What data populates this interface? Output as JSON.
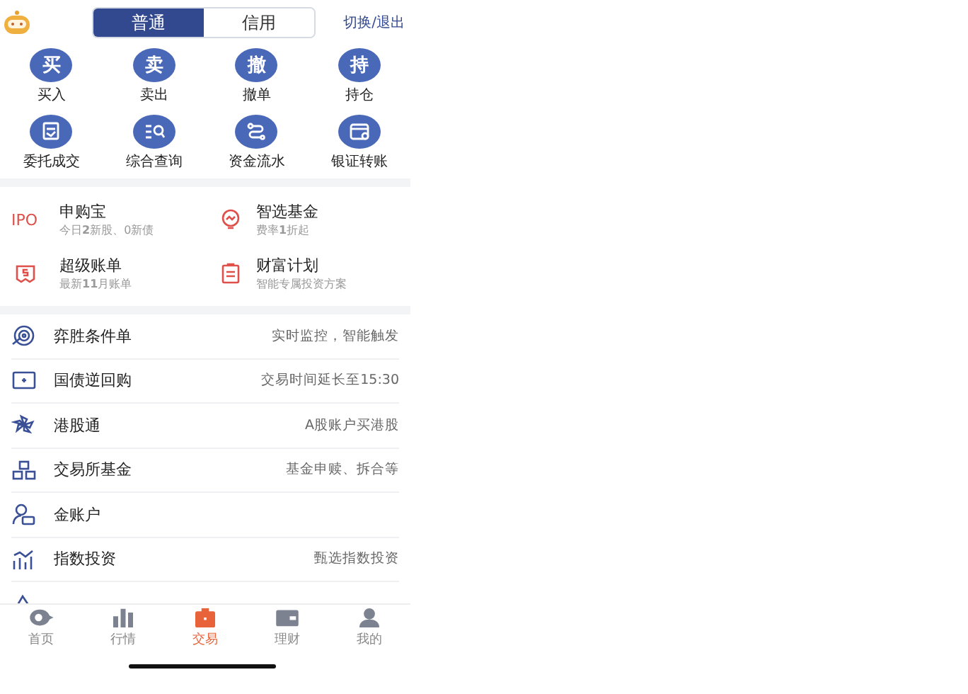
{
  "header": {
    "segments": [
      {
        "label": "普通",
        "selected": true
      },
      {
        "label": "信用",
        "selected": false
      }
    ],
    "switch_link": "切换/退出"
  },
  "quick_actions": [
    {
      "glyph": "买",
      "label": "买入",
      "kind": "glyph"
    },
    {
      "glyph": "卖",
      "label": "卖出",
      "kind": "glyph"
    },
    {
      "glyph": "撤",
      "label": "撤单",
      "kind": "glyph"
    },
    {
      "glyph": "持",
      "label": "持仓",
      "kind": "glyph"
    },
    {
      "label": "委托成交",
      "kind": "order"
    },
    {
      "label": "综合查询",
      "kind": "query"
    },
    {
      "label": "资金流水",
      "kind": "flow"
    },
    {
      "label": "银证转账",
      "kind": "card"
    }
  ],
  "features": [
    {
      "icon_text": "IPO",
      "kind": "text",
      "title": "申购宝",
      "subtitle": "今日**2**新股、0新债"
    },
    {
      "kind": "fund",
      "title": "智选基金",
      "subtitle": "费率**1**折起"
    },
    {
      "kind": "bill",
      "title": "超级账单",
      "subtitle": "最新**11**月账单"
    },
    {
      "kind": "plan",
      "title": "财富计划",
      "subtitle": "智能专属投资方案"
    }
  ],
  "services": [
    {
      "kind": "target",
      "title": "弈胜条件单",
      "note": "实时监控，智能触发"
    },
    {
      "kind": "screen",
      "title": "国债逆回购",
      "note": "交易时间延长至15:30"
    },
    {
      "kind": "flower",
      "title": "港股通",
      "note": "A股账户买港股"
    },
    {
      "kind": "blocks",
      "title": "交易所基金",
      "note": "基金申赎、拆合等"
    },
    {
      "kind": "person",
      "title": "金账户"
    },
    {
      "kind": "chart",
      "title": "指数投资",
      "note": "甄选指数投资"
    },
    {
      "kind": "triangle"
    }
  ],
  "tab_bar": [
    {
      "label": "首页",
      "kind": "home",
      "selected": false
    },
    {
      "label": "行情",
      "kind": "market",
      "selected": false
    },
    {
      "label": "交易",
      "kind": "trade",
      "selected": true
    },
    {
      "label": "理财",
      "kind": "wallet",
      "selected": false
    },
    {
      "label": "我的",
      "kind": "me",
      "selected": false
    }
  ]
}
